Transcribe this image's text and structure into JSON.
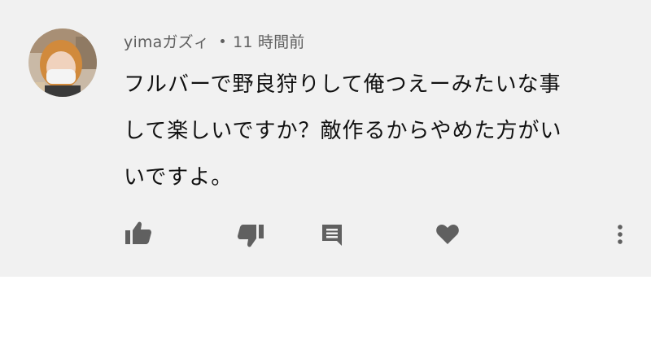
{
  "comment": {
    "author": "yimaガズィ",
    "separator": "•",
    "timestamp": "11 時間前",
    "text_lines": [
      "フルバーで野良狩りして俺つえーみたいな事",
      "して楽しいですか？敵作るからやめた方がい",
      "いですよ。"
    ]
  },
  "actions": {
    "like_icon": "thumb-up-icon",
    "dislike_icon": "thumb-down-icon",
    "reply_icon": "comment-reply-icon",
    "heart_icon": "heart-icon",
    "more_icon": "more-vertical-icon"
  },
  "colors": {
    "card_background": "#f1f1f1",
    "icon_color": "#606060",
    "meta_text": "#5f5f5f",
    "body_text": "#111111"
  }
}
